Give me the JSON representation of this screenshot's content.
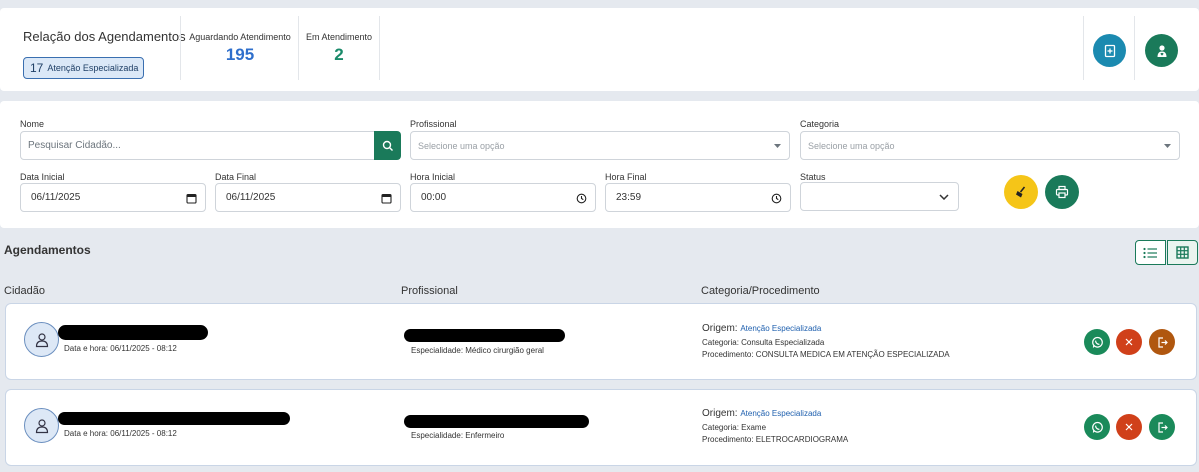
{
  "header": {
    "title": "Relação dos Agendamentos",
    "badge_count": "17",
    "badge_label": "Atenção Especializada",
    "stats": [
      {
        "label": "Aguardando Atendimento",
        "value": "195",
        "color": "#2f6fcc"
      },
      {
        "label": "Em Atendimento",
        "value": "2",
        "color": "#1a8a6a"
      }
    ]
  },
  "filters": {
    "nome_label": "Nome",
    "nome_placeholder": "Pesquisar Cidadão...",
    "profissional_label": "Profissional",
    "profissional_placeholder": "Selecione uma opção",
    "categoria_label": "Categoria",
    "categoria_placeholder": "Selecione uma opção",
    "data_inicial_label": "Data Inicial",
    "data_inicial_value": "06/11/2025",
    "data_final_label": "Data Final",
    "data_final_value": "06/11/2025",
    "hora_inicial_label": "Hora Inicial",
    "hora_inicial_value": "00:00",
    "hora_final_label": "Hora Final",
    "hora_final_value": "23:59",
    "status_label": "Status",
    "status_value": ""
  },
  "list": {
    "title": "Agendamentos",
    "columns": [
      "Cidadão",
      "Profissional",
      "Categoria/Procedimento"
    ],
    "rows": [
      {
        "datetime": "Data e hora: 06/11/2025 - 08:12",
        "specialty": "Especialidade: Médico cirurgião geral",
        "origem_label": "Origem:",
        "origem_value": "Atenção Especializada",
        "categoria": "Categoria: Consulta Especializada",
        "procedimento": "Procedimento: CONSULTA MEDICA EM ATENÇÃO ESPECIALIZADA",
        "third_action_color": "#b0570f"
      },
      {
        "datetime": "Data e hora: 06/11/2025 - 08:12",
        "specialty": "Especialidade: Enfermeiro",
        "origem_label": "Origem:",
        "origem_value": "Atenção Especializada",
        "categoria": "Categoria: Exame",
        "procedimento": "Procedimento: ELETROCARDIOGRAMA",
        "third_action_color": "#1a8a5a"
      }
    ]
  },
  "colors": {
    "primary_green": "#1a7a5a",
    "teal": "#1b8ab0",
    "yellow": "#f5c518",
    "danger": "#d0401a"
  },
  "icons": [
    "plus-document-icon",
    "person-heart-icon",
    "search-icon",
    "calendar-icon",
    "clock-icon",
    "chevron-down-icon",
    "broom-icon",
    "printer-icon",
    "list-view-icon",
    "grid-view-icon",
    "user-icon",
    "whatsapp-icon",
    "close-icon",
    "exit-icon"
  ]
}
